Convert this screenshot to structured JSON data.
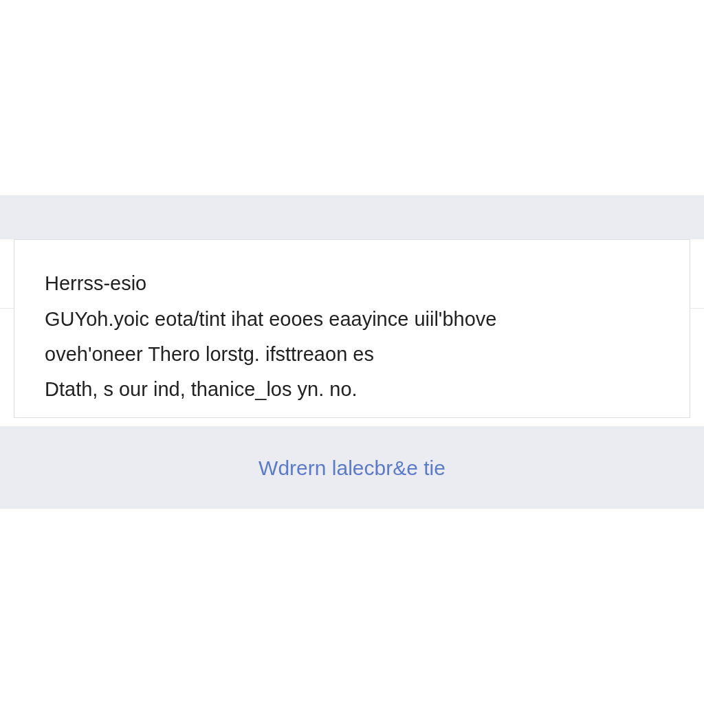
{
  "card": {
    "title": "Herrss-esio",
    "lines": [
      "GUYoh.yoic eota/tint  ihat  eooes eaayince  uiil'bhove",
      "oveh'oneer Thero lorstg. ifsttreaon es",
      "Dtath,  s  our ind, thanice_los yn. no."
    ]
  },
  "footer": {
    "link": "Wdrern lalecbr&e tie"
  }
}
